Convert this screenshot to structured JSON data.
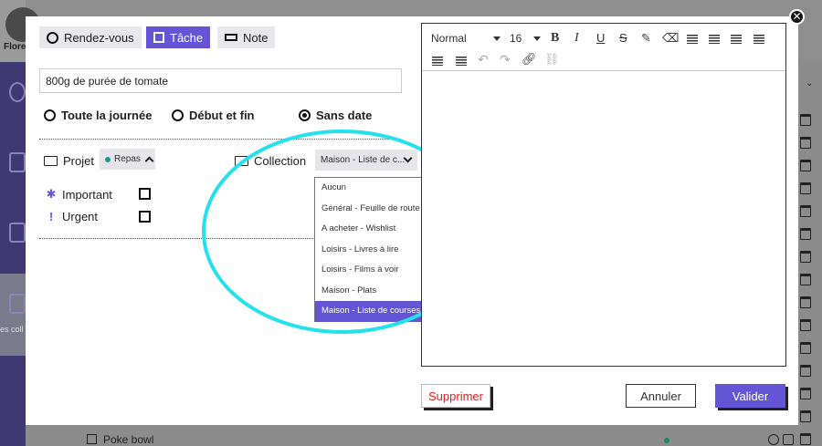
{
  "background": {
    "user_label": "Flore",
    "sidebar_label": "es coll",
    "bottom_row_label": "Poke bowl"
  },
  "modal": {
    "types": [
      {
        "label": "Rendez-vous",
        "active": false
      },
      {
        "label": "Tâche",
        "active": true
      },
      {
        "label": "Note",
        "active": false
      }
    ],
    "title_value": "800g de purée de tomate",
    "time_options": [
      {
        "label": "Toute la journée",
        "selected": false
      },
      {
        "label": "Début et fin",
        "selected": false
      },
      {
        "label": "Sans date",
        "selected": true
      }
    ],
    "project": {
      "label": "Projet",
      "value": "Repas"
    },
    "collection": {
      "label": "Collection",
      "value": "Maison - Liste de c...",
      "options": [
        "Aucun",
        "Général - Feuille de route",
        "A acheter - Wishlist",
        "Loisirs - Livres à lire",
        "Loisirs - Films à voir",
        "Maison - Plats",
        "Maison - Liste de courses"
      ],
      "selected_index": 6
    },
    "flags": [
      {
        "icon": "✱",
        "label": "Important",
        "checked": false
      },
      {
        "icon": "!",
        "label": "Urgent",
        "checked": false
      }
    ],
    "editor": {
      "format": "Normal",
      "font_size": "16"
    },
    "buttons": {
      "delete": "Supprimer",
      "cancel": "Annuler",
      "ok": "Valider"
    }
  },
  "colors": {
    "accent": "#6355d6",
    "highlight": "#25e2ea",
    "danger": "#e02020"
  }
}
